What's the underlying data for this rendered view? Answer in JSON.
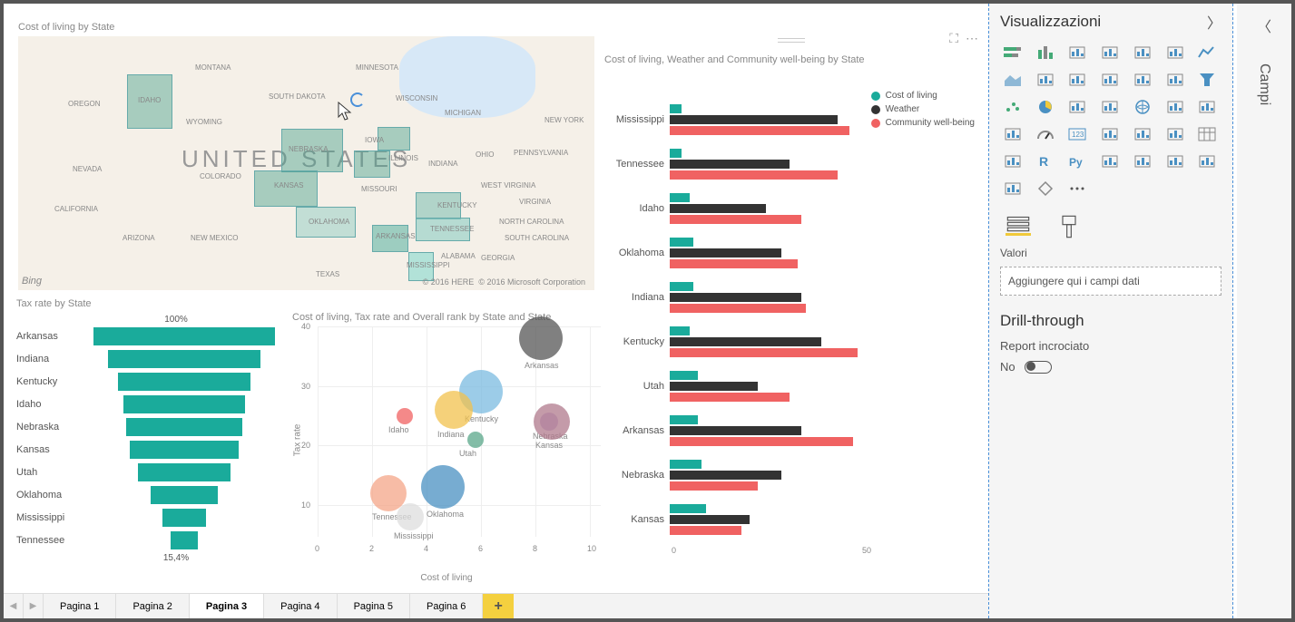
{
  "map": {
    "title": "Cost of living by State",
    "big_label": "UNITED STATES",
    "labels": [
      "OREGON",
      "IDAHO",
      "NEVADA",
      "CALIFORNIA",
      "ARIZONA",
      "NEW MEXICO",
      "WYOMING",
      "COLORADO",
      "MONTANA",
      "SOUTH DAKOTA",
      "NEBRASKA",
      "KANSAS",
      "OKLAHOMA",
      "TEXAS",
      "MINNESOTA",
      "IOWA",
      "MISSOURI",
      "ARKANSAS",
      "WISCONSIN",
      "ILLINOIS",
      "MICHIGAN",
      "INDIANA",
      "OHIO",
      "KENTUCKY",
      "TENNESSEE",
      "MISSISSIPPI",
      "ALABAMA",
      "GEORGIA",
      "SOUTH CAROLINA",
      "NORTH CAROLINA",
      "WEST VIRGINIA",
      "VIRGINIA",
      "PENNSYLVANIA",
      "NEW YORK"
    ],
    "bing": "Bing",
    "copyright1": "© 2016 HERE",
    "copyright2": "© 2016 Microsoft Corporation"
  },
  "funnel": {
    "title": "Tax rate by State",
    "top_pct": "100%",
    "bottom_pct": "15,4%",
    "categories": [
      "Arkansas",
      "Indiana",
      "Kentucky",
      "Idaho",
      "Nebraska",
      "Kansas",
      "Utah",
      "Oklahoma",
      "Mississippi",
      "Tennessee"
    ]
  },
  "scatter": {
    "title": "Cost of living, Tax rate and Overall rank by State and State",
    "xlabel": "Cost of living",
    "ylabel": "Tax rate",
    "yticks": [
      "10",
      "20",
      "30",
      "40"
    ],
    "xticks": [
      "0",
      "2",
      "4",
      "6",
      "8",
      "10"
    ]
  },
  "bars": {
    "title": "Cost of living, Weather and Community well-being by State",
    "legend": [
      "Cost of living",
      "Weather",
      "Community well-being"
    ],
    "xticks": [
      "0",
      "50"
    ]
  },
  "tabs": [
    "Pagina 1",
    "Pagina 2",
    "Pagina 3",
    "Pagina 4",
    "Pagina 5",
    "Pagina 6"
  ],
  "panel": {
    "title": "Visualizzazioni",
    "valori": "Valori",
    "drop_hint": "Aggiungere qui i campi dati",
    "drill_title": "Drill-through",
    "drill_label": "Report incrociato",
    "toggle_text": "No"
  },
  "campi": {
    "label": "Campi"
  },
  "viz_icons": [
    "stacked-bar",
    "clustered-column",
    "clustered-bar-group",
    "column-multi",
    "stacked-100",
    "column-100",
    "line",
    "area",
    "stacked-area",
    "line-column",
    "line-column2",
    "ribbon",
    "waterfall",
    "funnel-vis",
    "scatter-vis",
    "pie",
    "donut",
    "treemap",
    "map",
    "filled-map",
    "shape-map",
    "azure-map",
    "gauge",
    "card",
    "multi-row-card",
    "kpi",
    "slicer",
    "table",
    "matrix",
    "r-visual",
    "python-visual",
    "key-influencers",
    "decomposition",
    "qna",
    "paginated",
    "powerapps",
    "diamond",
    "more-icon"
  ],
  "chart_data": [
    {
      "type": "funnel",
      "title": "Tax rate by State",
      "categories": [
        "Arkansas",
        "Indiana",
        "Kentucky",
        "Idaho",
        "Nebraska",
        "Kansas",
        "Utah",
        "Oklahoma",
        "Mississippi",
        "Tennessee"
      ],
      "values_pct": [
        100,
        84,
        73,
        67,
        64,
        60,
        51,
        37,
        24,
        15.4
      ]
    },
    {
      "type": "scatter",
      "title": "Cost of living, Tax rate and Overall rank by State and State",
      "xlabel": "Cost of living",
      "ylabel": "Tax rate",
      "xlim": [
        0,
        10
      ],
      "ylim": [
        5,
        40
      ],
      "points": [
        {
          "name": "Arkansas",
          "x": 8.2,
          "y": 38,
          "size": 48,
          "color": "#555"
        },
        {
          "name": "Kentucky",
          "x": 6.0,
          "y": 29,
          "size": 48,
          "color": "#7bbbe0"
        },
        {
          "name": "Indiana",
          "x": 5.0,
          "y": 26,
          "size": 42,
          "color": "#f2c14e"
        },
        {
          "name": "Idaho",
          "x": 3.2,
          "y": 25,
          "size": 18,
          "color": "#f06262"
        },
        {
          "name": "Utah",
          "x": 5.8,
          "y": 21,
          "size": 18,
          "color": "#5aa789"
        },
        {
          "name": "Nebraska",
          "x": 8.5,
          "y": 24,
          "size": 20,
          "color": "#b8a1d6"
        },
        {
          "name": "Kansas",
          "x": 8.6,
          "y": 24,
          "size": 40,
          "color": "#b07a8c"
        },
        {
          "name": "Oklahoma",
          "x": 4.6,
          "y": 13,
          "size": 48,
          "color": "#4a90c2"
        },
        {
          "name": "Tennessee",
          "x": 2.6,
          "y": 12,
          "size": 40,
          "color": "#f4a688"
        },
        {
          "name": "Mississippi",
          "x": 3.4,
          "y": 8,
          "size": 30,
          "color": "#ddd"
        }
      ]
    },
    {
      "type": "bar",
      "title": "Cost of living, Weather and Community well-being by State",
      "categories": [
        "Mississippi",
        "Tennessee",
        "Idaho",
        "Oklahoma",
        "Indiana",
        "Kentucky",
        "Utah",
        "Arkansas",
        "Nebraska",
        "Kansas"
      ],
      "series": [
        {
          "name": "Cost of living",
          "color": "#1aab9b",
          "values": [
            3,
            3,
            5,
            6,
            6,
            5,
            7,
            7,
            8,
            9
          ]
        },
        {
          "name": "Weather",
          "color": "#333",
          "values": [
            42,
            30,
            24,
            28,
            33,
            38,
            22,
            33,
            28,
            20
          ]
        },
        {
          "name": "Community well-being",
          "color": "#f06262",
          "values": [
            45,
            42,
            33,
            32,
            34,
            47,
            30,
            46,
            22,
            18
          ]
        }
      ],
      "xlim": [
        0,
        50
      ]
    }
  ]
}
